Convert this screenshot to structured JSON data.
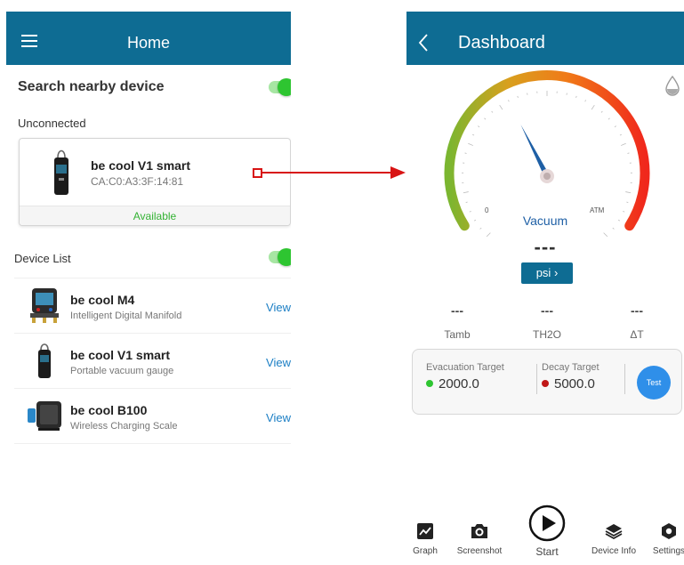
{
  "home": {
    "title": "Home",
    "search": {
      "title": "Search nearby device",
      "enabled": true
    },
    "unconnected_label": "Unconnected",
    "unconnected_device": {
      "name": "be cool V1 smart",
      "mac": "CA:C0:A3:3F:14:81",
      "status": "Available"
    },
    "device_list": {
      "title": "Device List",
      "enabled": true,
      "items": [
        {
          "name": "be cool M4",
          "subtitle": "Intelligent Digital Manifold",
          "action": "View",
          "icon": "manifold-icon"
        },
        {
          "name": "be cool V1 smart",
          "subtitle": "Portable vacuum gauge",
          "action": "View",
          "icon": "vacuum-gauge-icon"
        },
        {
          "name": "be cool B100",
          "subtitle": "Wireless Charging Scale",
          "action": "View",
          "icon": "scale-icon"
        }
      ]
    }
  },
  "dashboard": {
    "title": "Dashboard",
    "gauge": {
      "label": "Vacuum",
      "value": "---",
      "min_label": "0",
      "max_label": "ATM",
      "needle_level": 0.4
    },
    "unit_button": "psi",
    "readings": [
      {
        "value": "---",
        "label": "Tamb"
      },
      {
        "value": "---",
        "label": "TH2O"
      },
      {
        "value": "---",
        "label": "ΔT"
      }
    ],
    "evacuation_target": {
      "label": "Evacuation Target",
      "value": "2000.0",
      "color": "#2ec531"
    },
    "decay_target": {
      "label": "Decay Target",
      "value": "5000.0",
      "color": "#c01818"
    },
    "test_button": "Test",
    "nav": {
      "graph": "Graph",
      "screenshot": "Screenshot",
      "start": "Start",
      "device_info": "Device Info",
      "settings": "Settings"
    }
  },
  "colors": {
    "appbar": "#0e6c93",
    "toggle_on": "#2ec531",
    "available": "#33b233",
    "link": "#1a7ec4",
    "annotation_arrow": "#d81414"
  }
}
